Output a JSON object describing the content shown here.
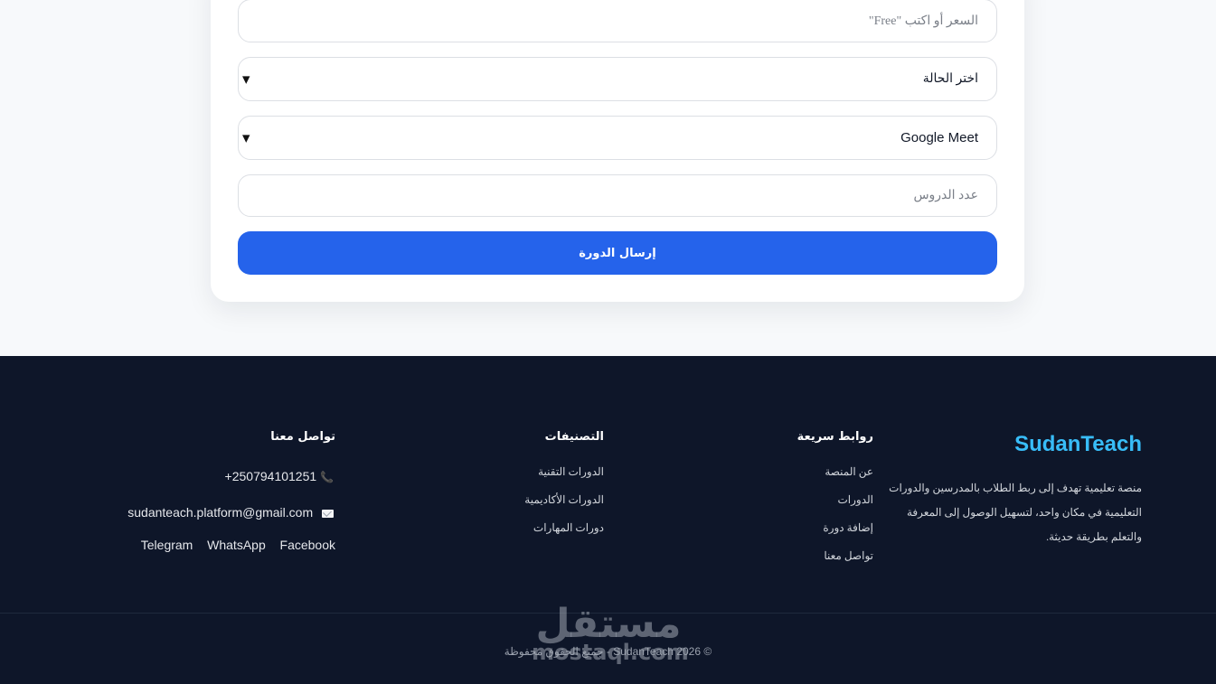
{
  "form": {
    "price_placeholder": "السعر أو اكتب \"Free\"",
    "status_select": "اختر الحالة",
    "platform_select": "Google Meet",
    "lessons_placeholder": "عدد الدروس",
    "submit_label": "إرسال الدورة"
  },
  "footer": {
    "brand": "SudanTeach",
    "about": "منصة تعليمية تهدف إلى ربط الطلاب بالمدرسين والدورات التعليمية في مكان واحد، لتسهيل الوصول إلى المعرفة والتعلم بطريقة حديثة.",
    "quick_links": {
      "title": "روابط سريعة",
      "items": [
        "عن المنصة",
        "الدورات",
        "إضافة دورة",
        "تواصل معنا"
      ]
    },
    "categories": {
      "title": "التصنيفات",
      "items": [
        "الدورات التقنية",
        "الدورات الأكاديمية",
        "دورات المهارات"
      ]
    },
    "contact": {
      "title": "تواصل معنا",
      "phone": "+250794101251",
      "email": "sudanteach.platform@gmail.com",
      "social": [
        "Facebook",
        "WhatsApp",
        "Telegram"
      ]
    },
    "copyright": "© 2026 SudanTeach - جميع الحقوق محفوظة"
  },
  "watermark": {
    "arabic": "مستقل",
    "latin": "mostaql.com"
  },
  "colors": {
    "accent": "#2563eb",
    "brand": "#38bdf8",
    "footer_bg": "#0e1629"
  }
}
